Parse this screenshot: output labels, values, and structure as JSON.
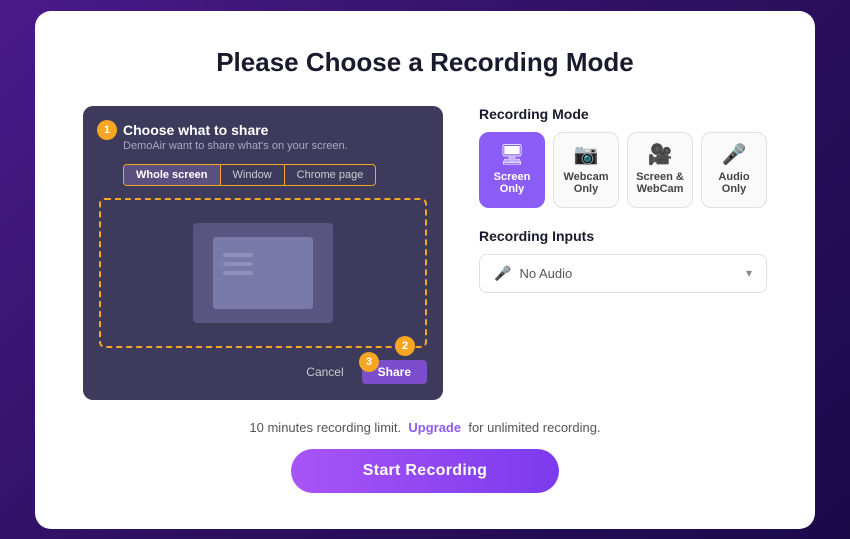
{
  "page": {
    "title": "Please Choose a Recording Mode"
  },
  "dialog": {
    "title": "Choose what to share",
    "subtitle": "DemoAir want to share what's on your screen.",
    "tabs": [
      {
        "label": "Whole screen",
        "active": true
      },
      {
        "label": "Window",
        "active": false
      },
      {
        "label": "Chrome page",
        "active": false
      }
    ],
    "cancel_label": "Cancel",
    "share_label": "Share"
  },
  "steps": [
    "1",
    "2",
    "3"
  ],
  "recording_mode": {
    "section_label": "Recording Mode",
    "modes": [
      {
        "id": "screen-only",
        "label": "Screen Only",
        "icon": "🖥",
        "active": true
      },
      {
        "id": "webcam-only",
        "label": "Webcam Only",
        "icon": "📷",
        "active": false
      },
      {
        "id": "screen-webcam",
        "label": "Screen & WebCam",
        "icon": "🎥",
        "active": false
      },
      {
        "id": "audio-only",
        "label": "Audio Only",
        "icon": "🎤",
        "active": false
      }
    ]
  },
  "recording_inputs": {
    "section_label": "Recording Inputs",
    "dropdown": {
      "value": "No Audio",
      "placeholder": "No Audio"
    }
  },
  "bottom": {
    "limit_text_before": "10 minutes recording limit.",
    "upgrade_label": "Upgrade",
    "limit_text_after": "for unlimited recording.",
    "start_button": "Start Recording"
  }
}
